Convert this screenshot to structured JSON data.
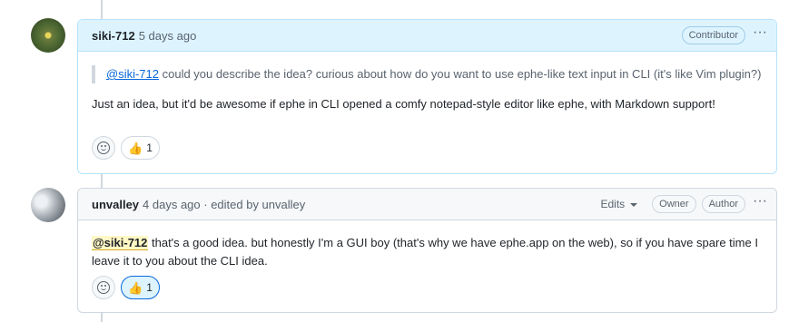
{
  "comments": [
    {
      "author": "siki-712",
      "meta": "5 days ago",
      "badges": [
        "Contributor"
      ],
      "quote": {
        "mention": "@siki-712",
        "text": " could you describe the idea? curious about how do you want to use ephe-like text input in CLI (it's like Vim plugin?)"
      },
      "body": "Just an idea, but it'd be awesome if ephe in CLI opened a comfy notepad-style editor like ephe, with Markdown support!",
      "reaction": {
        "emoji": "👍",
        "count": "1",
        "active": false
      }
    },
    {
      "author": "unvalley",
      "meta": "4 days ago · edited by unvalley",
      "edits_label": "Edits",
      "badges": [
        "Owner",
        "Author"
      ],
      "mention": "@siki-712",
      "body": " that's a good idea. but honestly I'm a GUI boy (that's why we have ephe.app on the web), so if you have spare time I leave it to you about the CLI idea.",
      "reaction": {
        "emoji": "👍",
        "count": "1",
        "active": true
      }
    }
  ],
  "more_icon": "kebab-horizontal-icon",
  "add_reaction_icon": "smiley-icon",
  "colors": {
    "accent": "#0969da",
    "highlight_header": "#ddf4ff",
    "mention_highlight": "#fff8c5"
  }
}
